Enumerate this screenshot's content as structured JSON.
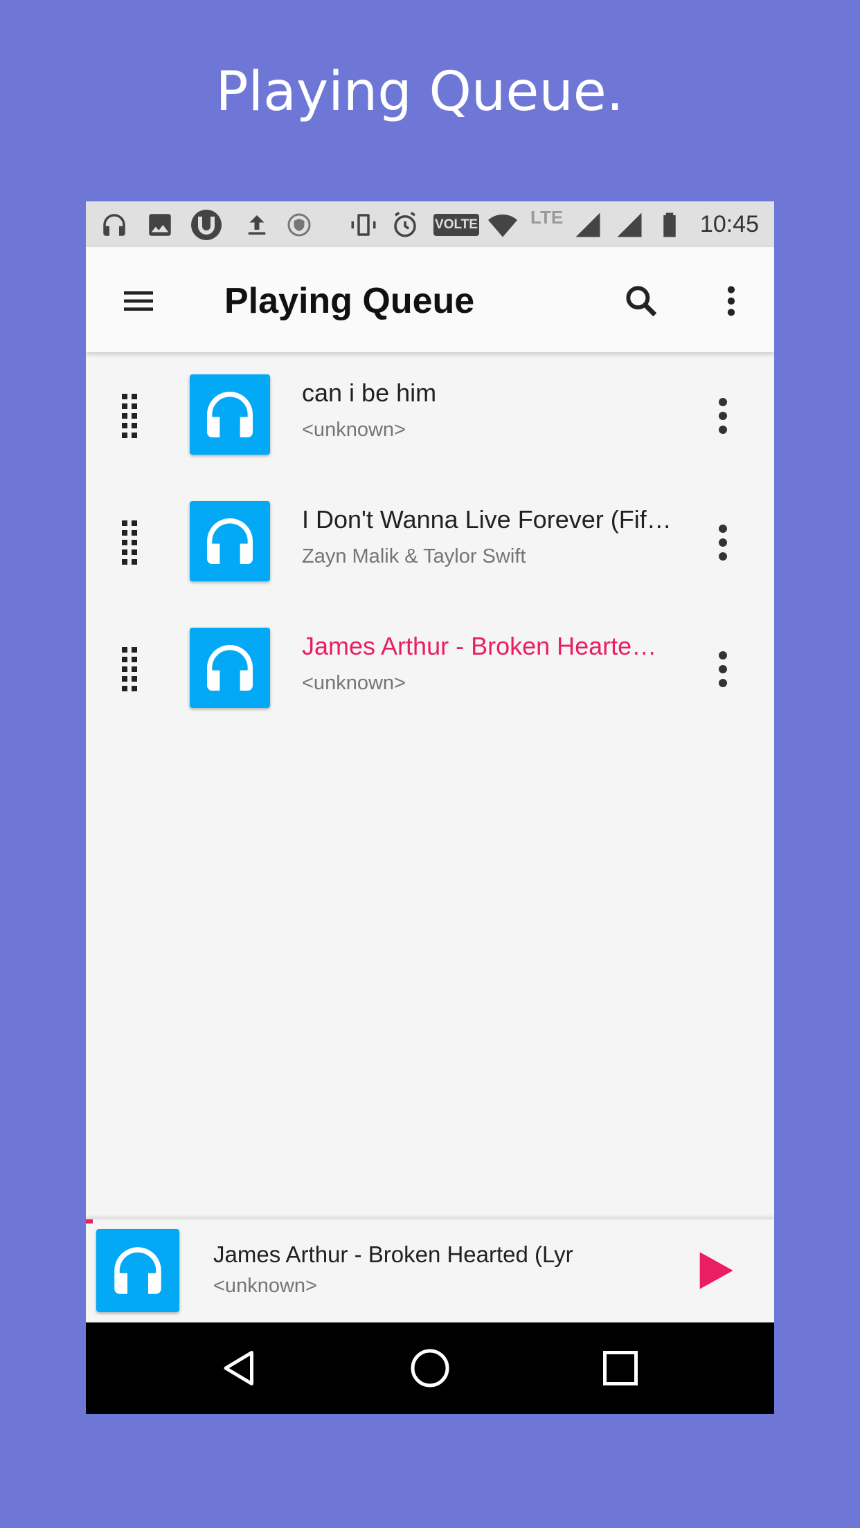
{
  "promo": {
    "title": "Playing Queue."
  },
  "status_bar": {
    "icons": [
      "headphones-icon",
      "image-icon",
      "utorrent-icon",
      "upload-icon",
      "shield-icon",
      "vibrate-icon",
      "alarm-icon",
      "volte-icon",
      "wifi-icon",
      "lte-icon",
      "signal-icon",
      "signal-icon",
      "battery-icon"
    ],
    "volte_label": "VOLTE",
    "lte_label": "LTE",
    "time": "10:45"
  },
  "app_bar": {
    "title": "Playing Queue",
    "menu_icon": "hamburger-menu-icon",
    "search_icon": "search-icon",
    "overflow_icon": "more-vert-icon"
  },
  "queue": [
    {
      "title": "can i be him",
      "subtitle": "<unknown>",
      "playing": false
    },
    {
      "title": "I Don't Wanna Live Forever (Fif…",
      "subtitle": "Zayn Malik & Taylor Swift",
      "playing": false
    },
    {
      "title": "James Arthur - Broken Hearte…",
      "subtitle": "<unknown>",
      "playing": true
    }
  ],
  "mini_player": {
    "title": "James Arthur - Broken Hearted (Lyrics On …",
    "subtitle": "<unknown>",
    "progress": 0.01,
    "play_icon": "play-icon"
  },
  "nav_bar": {
    "icons": [
      "back-icon",
      "home-icon",
      "recents-icon"
    ]
  },
  "colors": {
    "accent": "#e91e63",
    "art_blue": "#03a9f4",
    "background": "#6f77d6"
  }
}
